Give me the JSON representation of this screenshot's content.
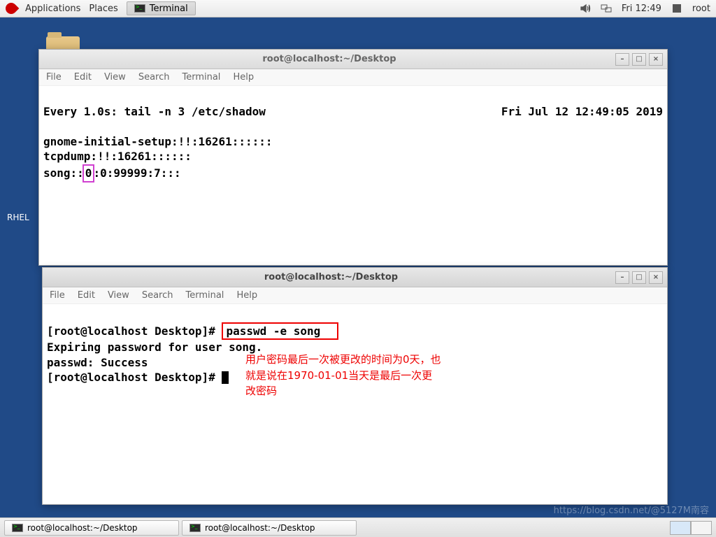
{
  "top_panel": {
    "applications": "Applications",
    "places": "Places",
    "active_app": "Terminal",
    "clock": "Fri 12:49",
    "user": "root"
  },
  "desktop": {
    "rhel_label": "RHEL"
  },
  "win1": {
    "title": "root@localhost:~/Desktop",
    "menu": {
      "file": "File",
      "edit": "Edit",
      "view": "View",
      "search": "Search",
      "terminal": "Terminal",
      "help": "Help"
    },
    "watch_left": "Every 1.0s: tail -n 3 /etc/shadow",
    "watch_right": "Fri Jul 12 12:49:05 2019",
    "line1": "gnome-initial-setup:!!:16261::::::",
    "line2": "tcpdump:!!:16261::::::",
    "line3_pre": "song::",
    "line3_hl": "0",
    "line3_post": ":0:99999:7:::"
  },
  "win2": {
    "title": "root@localhost:~/Desktop",
    "menu": {
      "file": "File",
      "edit": "Edit",
      "view": "View",
      "search": "Search",
      "terminal": "Terminal",
      "help": "Help"
    },
    "prompt1": "[root@localhost Desktop]# ",
    "cmd_hl": "passwd -e song  ",
    "out1": "Expiring password for user song.",
    "out2": "passwd: Success",
    "prompt2": "[root@localhost Desktop]# ",
    "annotation": "用户密码最后一次被更改的时间为0天，也就是说在1970-01-01当天是最后一次更改密码"
  },
  "taskbar": {
    "task1": "root@localhost:~/Desktop",
    "task2": "root@localhost:~/Desktop"
  },
  "watermark": "https://blog.csdn.net/@5127M南容"
}
